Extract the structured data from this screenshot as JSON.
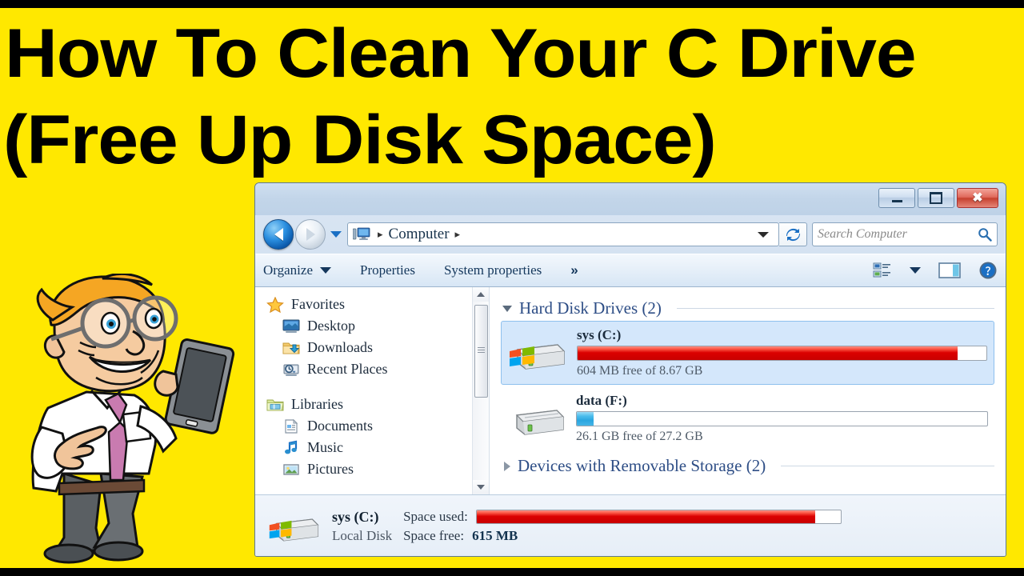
{
  "video": {
    "title_line1": "How To Clean Your C Drive",
    "title_line2": "(Free Up Disk Space)",
    "background_color": "#FFE800",
    "letterbox_color": "#000000"
  },
  "mascot": {
    "name": "cartoon-man-holding-tablet",
    "hair_color": "#F5A623",
    "tie_color": "#C97BB0",
    "shirt_color": "#FFFFFF",
    "trousers_color": "#5A5F63"
  },
  "window": {
    "controls": {
      "minimize_label": "–",
      "maximize_label": "□",
      "close_label": "✕"
    },
    "navigation": {
      "back_icon": "back-arrow-icon",
      "forward_icon": "forward-arrow-icon",
      "recent_icon": "recent-pages-dropdown-icon",
      "refresh_icon": "refresh-icon",
      "address_icon": "computer-icon",
      "breadcrumb": [
        "Computer"
      ],
      "separator": "▸"
    },
    "search": {
      "placeholder": "Search Computer",
      "icon": "search-icon"
    },
    "toolbar": {
      "organize_label": "Organize",
      "properties_label": "Properties",
      "system_properties_label": "System properties",
      "overflow_label": "»",
      "view_icon": "change-view-icon",
      "view_caret_icon": "chevron-down-icon",
      "preview_icon": "preview-pane-icon",
      "help_icon": "help-icon"
    }
  },
  "sidebar": {
    "groups": [
      {
        "label": "Favorites",
        "icon": "star-icon",
        "items": [
          {
            "label": "Desktop",
            "icon": "desktop-icon"
          },
          {
            "label": "Downloads",
            "icon": "downloads-folder-icon"
          },
          {
            "label": "Recent Places",
            "icon": "recent-places-icon"
          }
        ]
      },
      {
        "label": "Libraries",
        "icon": "libraries-folder-icon",
        "items": [
          {
            "label": "Documents",
            "icon": "documents-icon"
          },
          {
            "label": "Music",
            "icon": "music-note-icon"
          },
          {
            "label": "Pictures",
            "icon": "pictures-icon"
          }
        ]
      }
    ],
    "scrollbar": {
      "up_icon": "scroll-up-arrow-icon",
      "down_icon": "scroll-down-arrow-icon"
    }
  },
  "content": {
    "sections": [
      {
        "title": "Hard Disk Drives (2)",
        "expanded": true,
        "drives": [
          {
            "name": "sys (C:)",
            "icon": "windows-system-drive-icon",
            "free_text": "604 MB free of 8.67 GB",
            "used_percent": 93,
            "bar_color": "#DB0000",
            "selected": true
          },
          {
            "name": "data (F:)",
            "icon": "local-disk-icon",
            "free_text": "26.1 GB free of 27.2 GB",
            "used_percent": 4,
            "bar_color": "#2BA6E0",
            "selected": false
          }
        ]
      },
      {
        "title": "Devices with Removable Storage (2)",
        "expanded": false,
        "drives": []
      }
    ]
  },
  "status_bar": {
    "drive_icon": "windows-system-drive-icon",
    "name": "sys (C:)",
    "type": "Local Disk",
    "space_used_label": "Space used:",
    "space_free_label": "Space free:",
    "space_free_value": "615 MB",
    "used_percent": 93,
    "bar_color": "#DB0000"
  }
}
